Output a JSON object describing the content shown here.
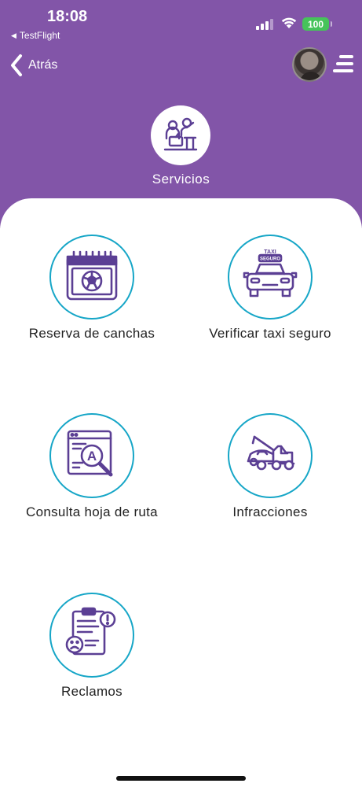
{
  "status_bar": {
    "time": "18:08",
    "back_app": "TestFlight",
    "battery": "100",
    "icons": [
      "signal-icon",
      "wifi-icon",
      "battery-icon"
    ]
  },
  "nav": {
    "back_label": "Atrás",
    "menu_icon": "hamburger-menu-icon"
  },
  "header": {
    "title": "Servicios",
    "icon": "services-people-icon"
  },
  "services": [
    {
      "label": "Reserva de canchas",
      "icon": "calendar-soccer-ball-icon"
    },
    {
      "label": "Verificar taxi seguro",
      "icon": "taxi-seguro-icon"
    },
    {
      "label": "Consulta hoja de ruta",
      "icon": "route-sheet-search-icon"
    },
    {
      "label": "Infracciones",
      "icon": "tow-truck-icon"
    },
    {
      "label": "Reclamos",
      "icon": "complaint-document-icon"
    }
  ],
  "taxi_sign": {
    "top": "TAXI",
    "bottom": "SEGURO"
  },
  "route_letter": "A",
  "colors": {
    "header_bg": "#8255a8",
    "icon_purple": "#5b3f94",
    "circle_border": "#16a6c7",
    "battery_green": "#46c35a"
  }
}
